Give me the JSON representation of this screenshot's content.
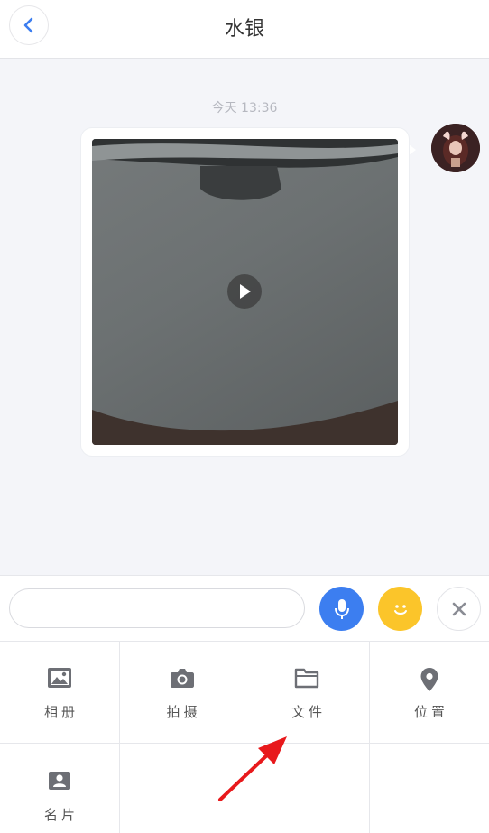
{
  "header": {
    "title": "水银",
    "back_icon": "chevron-left-icon",
    "accent": "#3c7ef0"
  },
  "chat": {
    "timestamp": "今天 13:36",
    "messages": [
      {
        "type": "video",
        "sender": "self",
        "avatar": "avatar"
      }
    ]
  },
  "input": {
    "placeholder": "",
    "value": "",
    "mic_icon": "microphone-icon",
    "emoji_icon": "smiley-icon",
    "close_icon": "close-icon",
    "mic_color": "#3c7ef0",
    "emoji_color": "#fbc52a"
  },
  "panel": {
    "items": [
      {
        "label": "相册",
        "icon": "image-icon"
      },
      {
        "label": "拍摄",
        "icon": "camera-icon"
      },
      {
        "label": "文件",
        "icon": "folder-icon"
      },
      {
        "label": "位置",
        "icon": "location-pin-icon"
      },
      {
        "label": "名片",
        "icon": "contact-card-icon"
      }
    ]
  },
  "annotation": {
    "color": "#e8191c",
    "points_to": "文件"
  }
}
